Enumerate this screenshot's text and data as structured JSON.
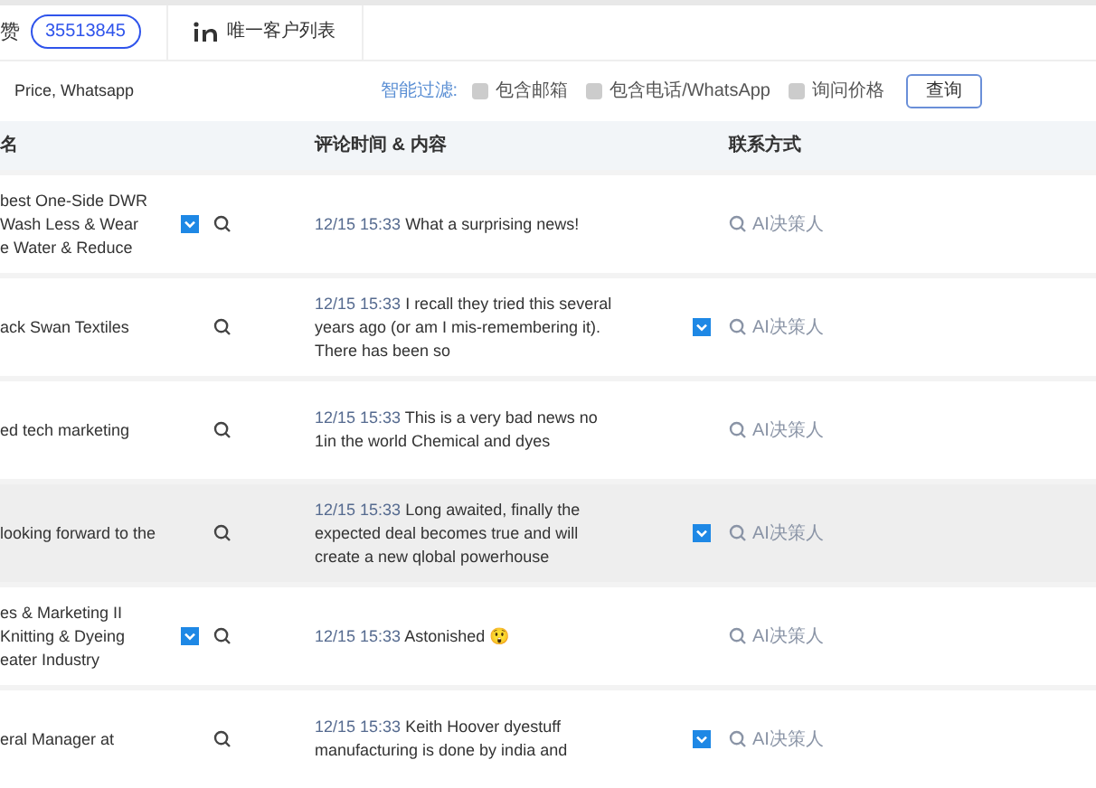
{
  "stats": {
    "label": "赞",
    "count": "35513845"
  },
  "list_link": {
    "label": "唯一客户列表"
  },
  "keywords": "Price, Whatsapp",
  "filter": {
    "label": "智能过滤:",
    "options": [
      {
        "label": "包含邮箱",
        "checked": false
      },
      {
        "label": "包含电话/WhatsApp",
        "checked": false
      },
      {
        "label": "询问价格",
        "checked": false
      }
    ],
    "button": "查询"
  },
  "table": {
    "columns": [
      "名",
      "评论时间 & 内容",
      "联系方式"
    ],
    "rows": [
      {
        "name": "best One-Side DWR\nWash Less & Wear\ne Water & Reduce",
        "name_more": true,
        "time": "12/15 15:33",
        "comment": "What a surprising news!",
        "comment_more": false,
        "contact": "AI决策人",
        "highlighted": false
      },
      {
        "name": "ack Swan Textiles",
        "name_more": false,
        "time": "12/15 15:33",
        "comment": "I recall they tried this several years ago (or am I mis-remembering it). There has been so",
        "comment_more": true,
        "contact": "AI决策人",
        "highlighted": false
      },
      {
        "name": "ed tech marketing",
        "name_more": false,
        "time": "12/15 15:33",
        "comment": "This is a very bad news no 1in the world Chemical and dyes",
        "comment_more": false,
        "contact": "AI决策人",
        "highlighted": false
      },
      {
        "name": "looking forward to the",
        "name_more": false,
        "time": "12/15 15:33",
        "comment": "Long awaited, finally the expected deal becomes true and will create a new qlobal powerhouse",
        "comment_more": true,
        "contact": "AI决策人",
        "highlighted": true
      },
      {
        "name": "es & Marketing II\n Knitting & Dyeing\neater Industry",
        "name_more": true,
        "time": "12/15 15:33",
        "comment": "Astonished 😲",
        "comment_more": false,
        "contact": "AI决策人",
        "highlighted": false
      },
      {
        "name": "eral Manager at",
        "name_more": false,
        "time": "12/15 15:33",
        "comment": "Keith Hoover dyestuff manufacturing is done by india and",
        "comment_more": true,
        "contact": "AI决策人",
        "highlighted": false
      }
    ]
  }
}
